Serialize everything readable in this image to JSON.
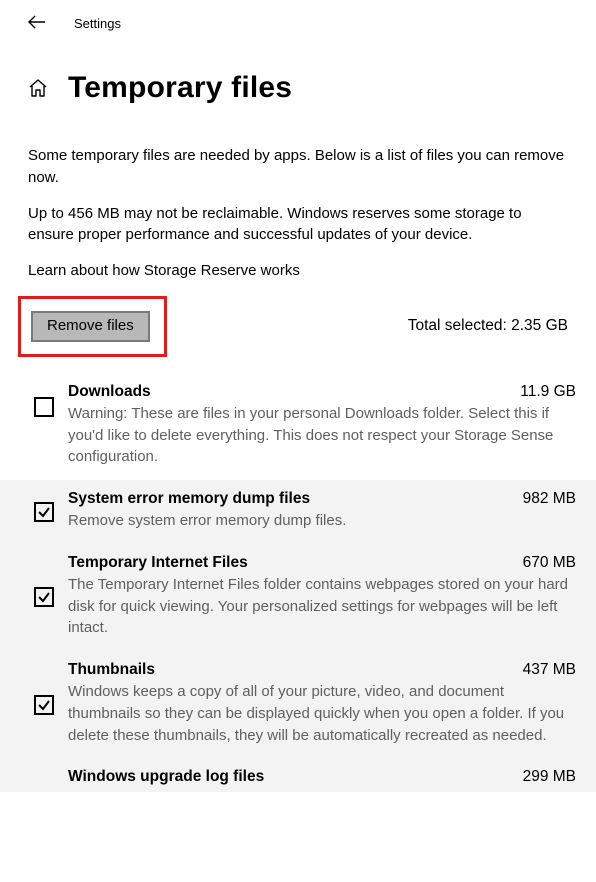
{
  "header": {
    "label": "Settings"
  },
  "page": {
    "title": "Temporary files",
    "para1": "Some temporary files are needed by apps. Below is a list of files you can remove now.",
    "para2": "Up to 456 MB may not be reclaimable. Windows reserves some storage to ensure proper performance and successful updates of your device.",
    "link": "Learn about how Storage Reserve works",
    "remove_button": "Remove files",
    "total_label": "Total selected: 2.35 GB"
  },
  "items": [
    {
      "name": "Downloads",
      "size": "11.9 GB",
      "desc": "Warning: These are files in your personal Downloads folder. Select this if you'd like to delete everything. This does not respect your Storage Sense configuration.",
      "checked": false
    },
    {
      "name": "System error memory dump files",
      "size": "982 MB",
      "desc": "Remove system error memory dump files.",
      "checked": true
    },
    {
      "name": "Temporary Internet Files",
      "size": "670 MB",
      "desc": "The Temporary Internet Files folder contains webpages stored on your hard disk for quick viewing. Your personalized settings for webpages will be left intact.",
      "checked": true
    },
    {
      "name": "Thumbnails",
      "size": "437 MB",
      "desc": "Windows keeps a copy of all of your picture, video, and document thumbnails so they can be displayed quickly when you open a folder. If you delete these thumbnails, they will be automatically recreated as needed.",
      "checked": true
    },
    {
      "name": "Windows upgrade log files",
      "size": "299 MB",
      "desc": "",
      "checked": false
    }
  ]
}
